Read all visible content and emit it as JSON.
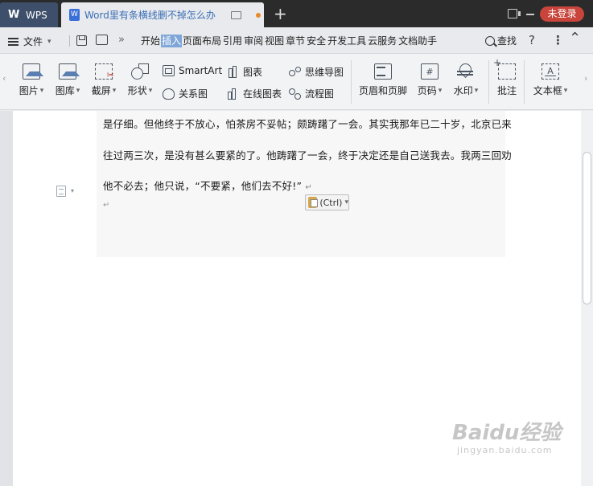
{
  "titlebar": {
    "app_tab_label": "WPS",
    "doc_tab_title": "Word里有条横线删不掉怎么办",
    "login_label": "未登录"
  },
  "menubar": {
    "file_label": "文件",
    "tabs": [
      "开始",
      "插入",
      "页面布局",
      "引用",
      "审阅",
      "视图",
      "章节",
      "安全",
      "开发工具",
      "云服务",
      "文档助手"
    ],
    "active_tab": "插入",
    "find_label": "查找",
    "help_label": "?"
  },
  "ribbon": {
    "picture": "图片",
    "gallery": "图库",
    "screenshot": "截屏",
    "shape": "形状",
    "smartart": "SmartArt",
    "chart": "图表",
    "mindmap": "思维导图",
    "relation": "关系图",
    "online_chart": "在线图表",
    "flowchart": "流程图",
    "header_footer": "页眉和页脚",
    "page_number": "页码",
    "watermark": "水印",
    "comment": "批注",
    "textbox": "文本框"
  },
  "document": {
    "lines": [
      "是仔细。但他终于不放心，怕茶房不妥帖；颇踌躇了一会。其实我那年已二十岁，北京已来",
      "往过两三次，是没有甚么要紧的了。他踌躇了一会，终于决定还是自己送我去。我两三回劝",
      "他不必去；他只说，“不要紧，他们去不好!”"
    ],
    "paste_option_label": "(Ctrl)"
  },
  "watermark": {
    "main": "Baidu经验",
    "sub": "jingyan.baidu.com"
  },
  "colors": {
    "titlebar_bg": "#2b2b2b",
    "accent_blue": "#7fa6d8",
    "login_red": "#c9453b"
  }
}
